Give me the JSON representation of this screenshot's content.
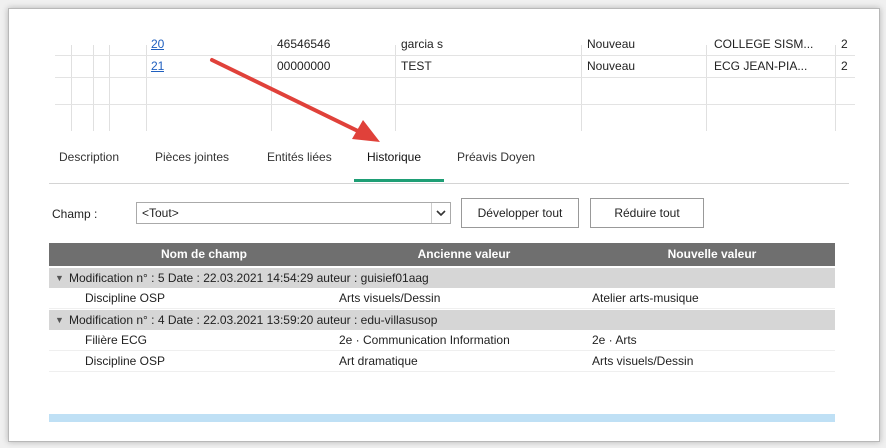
{
  "grid": {
    "rows": [
      {
        "num": "20",
        "id": "46546546",
        "name": "garcia s",
        "status": "Nouveau",
        "school": "COLLEGE SISM...",
        "extra": "2"
      },
      {
        "num": "21",
        "id": "00000000",
        "name": "TEST",
        "status": "Nouveau",
        "school": "ECG JEAN-PIA...",
        "extra": "2"
      }
    ]
  },
  "tabs": [
    "Description",
    "Pièces jointes",
    "Entités liées",
    "Historique",
    "Préavis Doyen"
  ],
  "filter": {
    "label": "Champ :",
    "value": "<Tout>",
    "expand_label": "Développer tout",
    "collapse_label": "Réduire tout"
  },
  "table": {
    "headers": [
      "Nom de champ",
      "Ancienne valeur",
      "Nouvelle valeur"
    ],
    "groups": [
      {
        "label": "Modification n° : 5 Date : 22.03.2021 14:54:29  auteur : guisief01aag",
        "rows": [
          {
            "field": "Discipline OSP",
            "old": "Arts visuels/Dessin",
            "new": "Atelier arts-musique"
          }
        ]
      },
      {
        "label": "Modification n° : 4 Date : 22.03.2021 13:59:20  auteur : edu-villasusop",
        "rows": [
          {
            "field": "Filière ECG",
            "old": "2e · Communication Information",
            "new": "2e · Arts"
          },
          {
            "field": "Discipline OSP",
            "old": "Art dramatique",
            "new": "Arts visuels/Dessin"
          }
        ]
      }
    ]
  },
  "colors": {
    "tab_underline": "#1e9e75",
    "arrow": "#e0413a",
    "header_bg": "#6f6f6f",
    "group_bg": "#d6d6d6"
  }
}
